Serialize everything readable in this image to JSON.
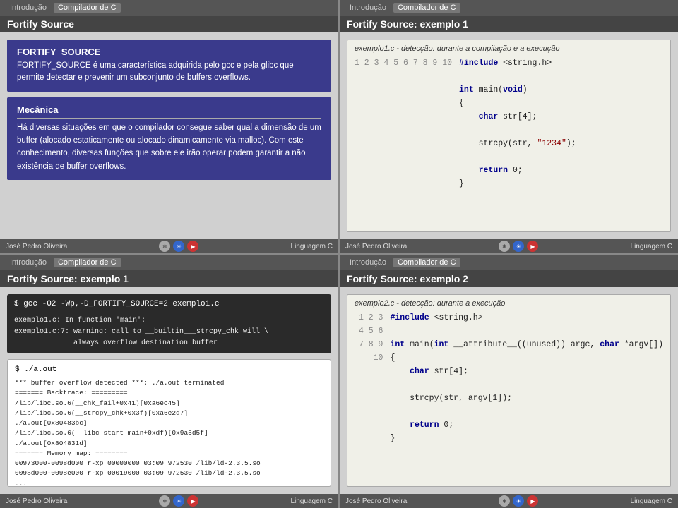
{
  "slides": [
    {
      "id": "slide1",
      "header_left_tabs": [
        "Introdução",
        "Compilador de C"
      ],
      "header_active": "Compilador de C",
      "title": "Fortify Source",
      "fortify_box": {
        "title": "FORTIFY_SOURCE",
        "text": "FORTIFY_SOURCE é uma característica adquirida pelo gcc e pela glibc que permite detectar e prevenir um subconjunto de buffers overflows."
      },
      "mecanica_box": {
        "title": "Mecânica",
        "text": "Há diversas situações em que o compilador consegue saber qual a dimensão de um buffer (alocado estaticamente ou alocado dinamicamente via malloc). Com este conhecimento, diversas funções que sobre ele irão operar podem garantir a não existência de buffer overflows."
      },
      "footer_left": "José Pedro Oliveira",
      "footer_right": "Linguagem C"
    },
    {
      "id": "slide2",
      "header_left_tabs": [
        "Introdução",
        "Compilador de C"
      ],
      "header_active": "Compilador de C",
      "title": "Fortify Source: exemplo 1",
      "code_header": "exemplo1.c - detecção: durante a compilação e a execução",
      "code_lines": [
        {
          "num": "1",
          "text": "#include <string.h>",
          "type": "include"
        },
        {
          "num": "2",
          "text": ""
        },
        {
          "num": "3",
          "text": "int main(void)",
          "type": "func"
        },
        {
          "num": "4",
          "text": "{"
        },
        {
          "num": "5",
          "text": "    char str[4];"
        },
        {
          "num": "6",
          "text": ""
        },
        {
          "num": "7",
          "text": "    strcpy(str, \"1234\");"
        },
        {
          "num": "8",
          "text": ""
        },
        {
          "num": "9",
          "text": "    return 0;"
        },
        {
          "num": "10",
          "text": "}"
        }
      ],
      "footer_left": "José Pedro Oliveira",
      "footer_right": "Linguagem C"
    },
    {
      "id": "slide3",
      "header_left_tabs": [
        "Introdução",
        "Compilador de C"
      ],
      "header_active": "Compilador de C",
      "title": "Fortify Source: exemplo 1",
      "gcc_cmd": "$ gcc -O2 -Wp,-D_FORTIFY_SOURCE=2 exemplo1.c",
      "gcc_warning": "exemplo1.c: In function 'main':\nexemplo1.c:7: warning: call to __builtin___strcpy_chk will \\\n              always overflow destination buffer",
      "run_cmd": "$ ./a.out",
      "run_output": "*** buffer overflow detected ***: ./a.out terminated\n======= Backtrace: =========\n/lib/libc.so.6(__chk_fail+0x41)[0xa6ec45]\n/lib/libc.so.6(__strcpy_chk+0x3f)[0xa6e2d7]\n./a.out[0x80483bc]\n/lib/libc.so.6(__libc_start_main+0xdf)[0x9a5d5f]\n./a.out[0x804831d]\n======= Memory map: ========\n00973000-0098d000 r-xp 00000000 03:09 972530 /lib/ld-2.3.5.so\n0098d000-0098e000 r-xp 00019000 03:09 972530 /lib/ld-2.3.5.so\n...",
      "footer_left": "José Pedro Oliveira",
      "footer_right": "Linguagem C"
    },
    {
      "id": "slide4",
      "header_left_tabs": [
        "Introdução",
        "Compilador de C"
      ],
      "header_active": "Compilador de C",
      "title": "Fortify Source: exemplo 2",
      "code_header": "exemplo2.c - detecção: durante a execução",
      "code_lines": [
        {
          "num": "1",
          "text": "#include <string.h>"
        },
        {
          "num": "2",
          "text": ""
        },
        {
          "num": "3",
          "text": "int main(int __attribute__((unused)) argc, char *argv[])"
        },
        {
          "num": "4",
          "text": "{"
        },
        {
          "num": "5",
          "text": "    char str[4];"
        },
        {
          "num": "6",
          "text": ""
        },
        {
          "num": "7",
          "text": "    strcpy(str, argv[1]);"
        },
        {
          "num": "8",
          "text": ""
        },
        {
          "num": "9",
          "text": "    return 0;"
        },
        {
          "num": "10",
          "text": "}"
        }
      ],
      "footer_left": "José Pedro Oliveira",
      "footer_right": "Linguagem C"
    }
  ],
  "labels": {
    "introducao": "Introdução",
    "compilador": "Compilador de C",
    "jose": "José Pedro Oliveira",
    "linguagem": "Linguagem C"
  }
}
